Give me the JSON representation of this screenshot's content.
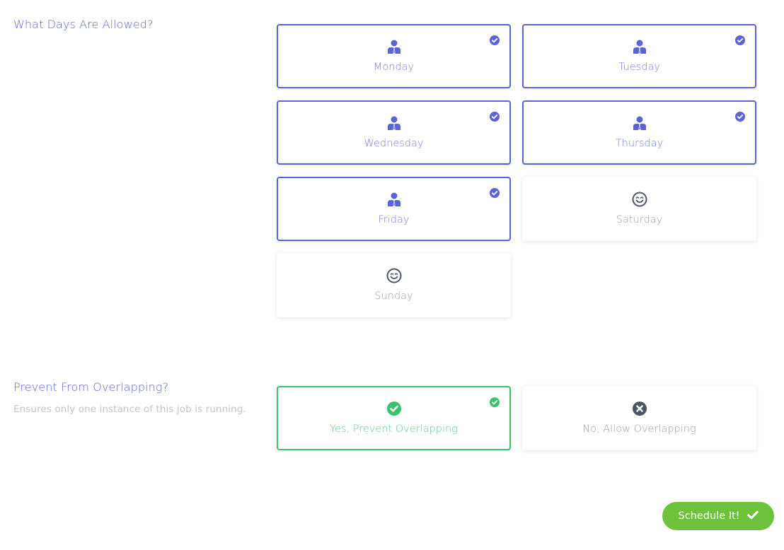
{
  "days_section": {
    "title": "What Days Are Allowed?",
    "options": [
      {
        "label": "Monday",
        "selected": true,
        "icon": "user-tie-icon"
      },
      {
        "label": "Tuesday",
        "selected": true,
        "icon": "user-tie-icon"
      },
      {
        "label": "Wednesday",
        "selected": true,
        "icon": "user-tie-icon"
      },
      {
        "label": "Thursday",
        "selected": true,
        "icon": "user-tie-icon"
      },
      {
        "label": "Friday",
        "selected": true,
        "icon": "user-tie-icon"
      },
      {
        "label": "Saturday",
        "selected": false,
        "icon": "smile-icon"
      },
      {
        "label": "Sunday",
        "selected": false,
        "icon": "smile-icon"
      }
    ]
  },
  "overlap_section": {
    "title": "Prevent From Overlapping?",
    "description": "Ensures only one instance of this job is running.",
    "options": [
      {
        "label": "Yes, Prevent Overlapping",
        "selected": true,
        "icon": "check-circle-icon"
      },
      {
        "label": "No, Allow Overlapping",
        "selected": false,
        "icon": "times-circle-icon"
      }
    ]
  },
  "submit_button": {
    "label": "Schedule It!",
    "icon": "check-icon"
  },
  "colors": {
    "accent": "#5b63d8",
    "success": "#3cc16b",
    "button": "#6cc33b",
    "muted_text": "#9da1a9"
  }
}
